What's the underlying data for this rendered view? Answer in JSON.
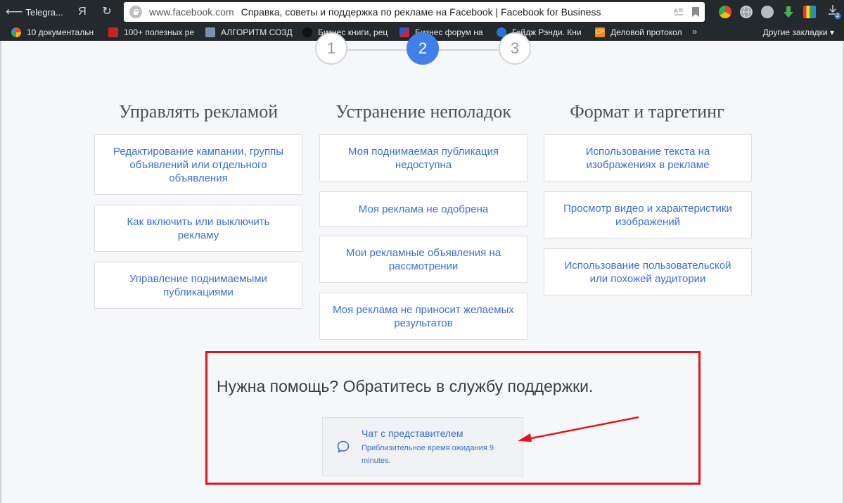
{
  "browser": {
    "back_label": "Telegra...",
    "ya_label": "Я",
    "reload_glyph": "↻",
    "domain": "www.facebook.com",
    "page_title": "Справка, советы и поддержка по рекламе на Facebook | Facebook for Business",
    "download_badge": "2"
  },
  "bookmarks": {
    "items": [
      {
        "label": "10 документальн",
        "icon": "pinwheel-icon",
        "color": "#e94b3c"
      },
      {
        "label": "100+ полезных ре",
        "icon": "rk-icon",
        "color": "#c0272d"
      },
      {
        "label": "АЛГОРИТМ СОЗД",
        "icon": "building-icon",
        "color": "#7a8fb0"
      },
      {
        "label": "Бизнес книги, рец",
        "icon": "b-logo-icon",
        "color": "#111111"
      },
      {
        "label": "Бизнес форум на",
        "icon": "flag-icon",
        "color": "#3355cc"
      },
      {
        "label": "Гейдж Рэнди. Кни",
        "icon": "globe-icon",
        "color": "#2f6fd1"
      },
      {
        "label": "Деловой протокол",
        "icon": "cp-icon",
        "color": "#e8891a"
      }
    ],
    "more_glyph": "»",
    "other_label": "Другие закладки",
    "other_caret": "▾"
  },
  "steps": [
    "1",
    "2",
    "3"
  ],
  "columns": [
    {
      "title": "Управлять рекламой",
      "cards": [
        "Редактирование кампании, группы объявлений или отдельного объявления",
        "Как включить или выключить рекламу",
        "Управление поднимаемыми публикациями"
      ]
    },
    {
      "title": "Устранение неполадок",
      "cards": [
        "Моя поднимаемая публикация недоступна",
        "Моя реклама не одобрена",
        "Мои рекламные объявления на рассмотрении",
        "Моя реклама не приносит желаемых результатов"
      ]
    },
    {
      "title": "Формат и таргетинг",
      "cards": [
        "Использование текста на изображениях в рекламе",
        "Просмотр видео и характеристики изображений",
        "Использование пользовательской или похожей аудитории"
      ]
    }
  ],
  "help": {
    "title": "Нужна помощь? Обратитесь в службу поддержки.",
    "chat_title": "Чат с представителем",
    "chat_subtitle": "Приблизительное время ожидания 9 minutes."
  },
  "colors": {
    "accent_blue": "#3b6fd4",
    "step_active": "#4080e8",
    "highlight_red": "#e3141b"
  }
}
